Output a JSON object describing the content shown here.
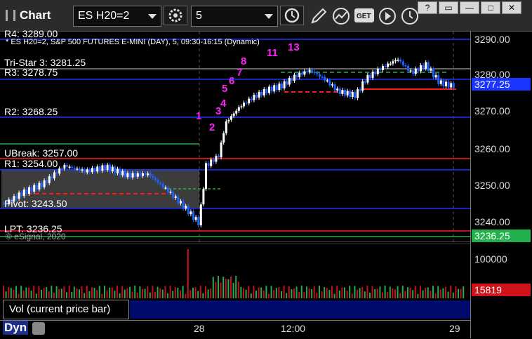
{
  "window": {
    "title": "Chart",
    "symbol": "ES H20=2",
    "interval": "5",
    "controls": [
      "?",
      "▭",
      "—",
      "□",
      "✕"
    ]
  },
  "chart": {
    "subtitle": "* ES H20=2, S&P 500 FUTURES E-MINI (DAY), 5, 09:30-16:15 (Dynamic)",
    "copyright": "© eSignal, 2020",
    "levels": {
      "r4": "R4: 3289.00",
      "tristar": "Tri-Star 3: 3281.25",
      "r3": "R3: 3278.75",
      "r2": "R2: 3268.25",
      "ubreak": "UBreak: 3257.00",
      "r1": "R1: 3254.00",
      "pivot": "Pivot: 3243.50",
      "lpt": "LPT: 3236.25"
    },
    "price_axis": [
      "3290.00",
      "3280.00",
      "3270.00",
      "3260.00",
      "3250.00",
      "3240.00"
    ],
    "current_price": "3277.25",
    "lpt_flag": "3236.25",
    "volume_axis": "100000",
    "volume_flag": "15819",
    "volume_legend": "Vol (current price bar)",
    "time_axis": [
      "28",
      "12:00",
      "29"
    ],
    "dyn_label": "Dyn",
    "counts_magenta": [
      "1",
      "2",
      "3",
      "4",
      "5",
      "6",
      "7",
      "8",
      "11",
      "13"
    ],
    "colors": {
      "up": "#ffffff",
      "down": "#1f5fff",
      "magenta": "#ff22ff",
      "green": "#22b14c",
      "level_blue": "#1a35ff",
      "level_red": "#ff1a1a"
    }
  }
}
